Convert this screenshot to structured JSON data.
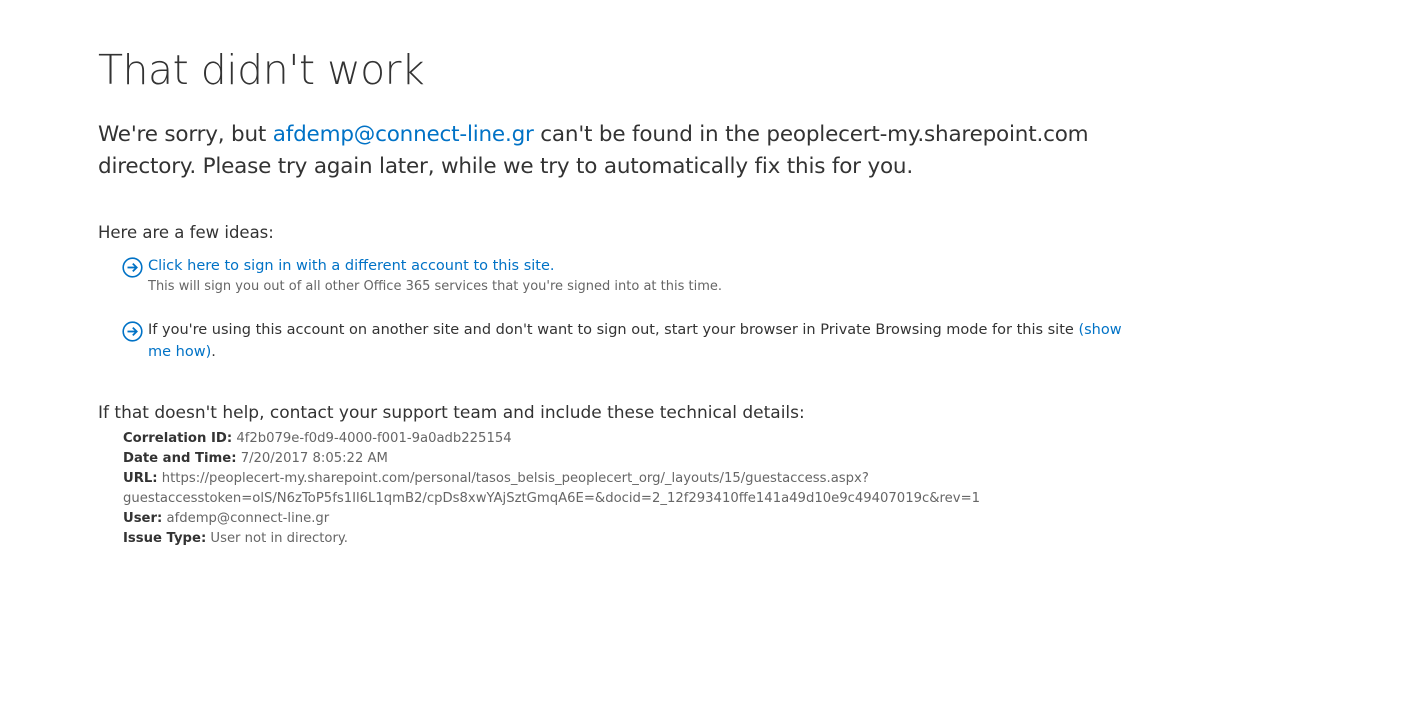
{
  "title": "That didn't work",
  "message": {
    "prefix": "We're sorry, but ",
    "account": "afdemp@connect-line.gr",
    "suffix": " can't be found in the peoplecert-my.sharepoint.com directory. Please try again later, while we try to automatically fix this for you."
  },
  "ideas": {
    "heading": "Here are a few ideas:",
    "items": [
      {
        "link_text": "Click here to sign in with a different account to this site.",
        "subtext": "This will sign you out of all other Office 365 services that you're signed into at this time."
      },
      {
        "text": "If you're using this account on another site and don't want to sign out, start your browser in Private Browsing mode for this site ",
        "link_text": "(show me how)",
        "trailing": "."
      }
    ],
    "icon": "circle-arrow-right-icon"
  },
  "help": {
    "heading": "If that doesn't help, contact your support team and include these technical details:",
    "details": {
      "correlation_label": "Correlation ID:",
      "correlation_value": "4f2b079e-f0d9-4000-f001-9a0adb225154",
      "datetime_label": "Date and Time:",
      "datetime_value": "7/20/2017 8:05:22 AM",
      "url_label": "URL:",
      "url_value_line1": "https://peoplecert-my.sharepoint.com/personal/tasos_belsis_peoplecert_org/_layouts/15/guestaccess.aspx?",
      "url_value_line2": "guestaccesstoken=olS/N6zToP5fs1Il6L1qmB2/cpDs8xwYAjSztGmqA6E=&docid=2_12f293410ffe141a49d10e9c49407019c&rev=1",
      "user_label": "User:",
      "user_value": "afdemp@connect-line.gr",
      "issue_label": "Issue Type:",
      "issue_value": "User not in directory."
    }
  },
  "colors": {
    "link": "#0072c6",
    "text": "#333333",
    "muted": "#666666",
    "background": "#ffffff"
  }
}
